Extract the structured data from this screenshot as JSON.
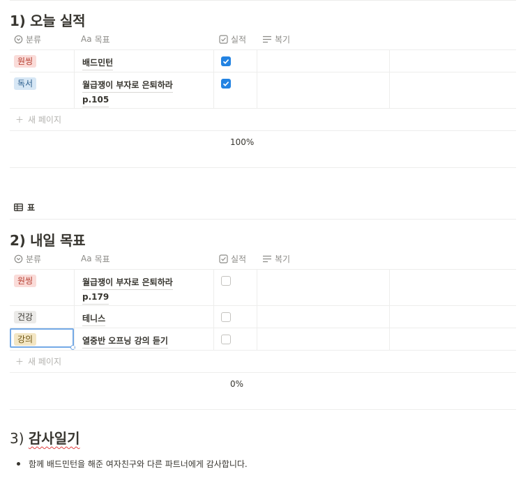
{
  "section1": {
    "title": "1) 오늘 실적",
    "headers": {
      "category": "분류",
      "goal": "목표",
      "done": "실적",
      "review": "복기",
      "goal_prefix": "Aa"
    },
    "rows": [
      {
        "category": "원씽",
        "tag_bg": "#fadcd9",
        "tag_fg": "#b53b2d",
        "goal_line1": "배드민턴",
        "goal_line2": "",
        "checked": true
      },
      {
        "category": "독서",
        "tag_bg": "#d7e7f5",
        "tag_fg": "#2a5d8c",
        "goal_line1": "월급쟁이 부자로 은퇴하라",
        "goal_line2": "p.105",
        "checked": true
      }
    ],
    "new_page": "새 페이지",
    "calc": "100%"
  },
  "view_tab": {
    "label": "표"
  },
  "section2": {
    "title": "2) 내일 목표",
    "headers": {
      "category": "분류",
      "goal": "목표",
      "done": "실적",
      "review": "복기",
      "goal_prefix": "Aa"
    },
    "rows": [
      {
        "category": "원씽",
        "tag_bg": "#fadcd9",
        "tag_fg": "#b53b2d",
        "goal_line1": "월급쟁이 부자로 은퇴하라",
        "goal_line2": "p.179",
        "checked": false
      },
      {
        "category": "건강",
        "tag_bg": "#ebeae8",
        "tag_fg": "#37352f",
        "goal_line1": "테니스",
        "goal_line2": "",
        "checked": false
      },
      {
        "category": "강의",
        "tag_bg": "#f3e6c4",
        "tag_fg": "#6e5411",
        "goal_line1": "열중반 오프닝 강의 듣기",
        "goal_line2": "",
        "checked": false
      }
    ],
    "new_page": "새 페이지",
    "calc": "0%"
  },
  "section3": {
    "prefix": "3) ",
    "title": "감사일기",
    "bullet": "함께 배드민턴을 해준 여자친구와 다른 파트너에게 감사합니다."
  }
}
